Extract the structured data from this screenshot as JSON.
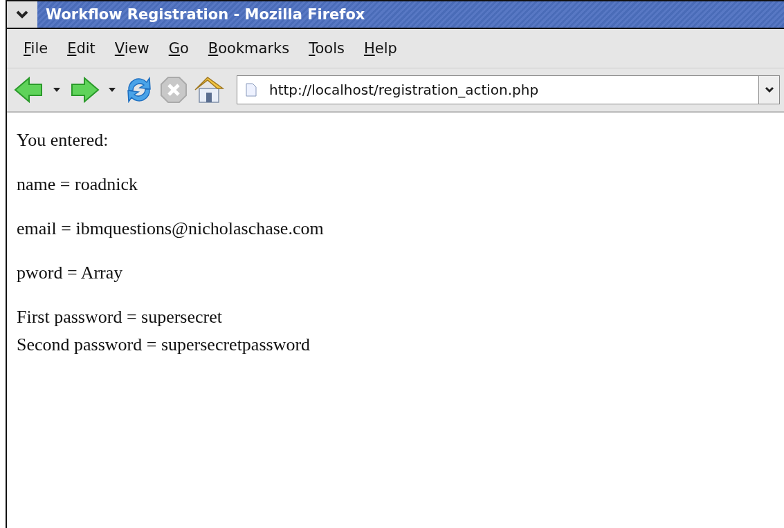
{
  "window": {
    "title": "Workflow Registration - Mozilla Firefox"
  },
  "menu": [
    "File",
    "Edit",
    "View",
    "Go",
    "Bookmarks",
    "Tools",
    "Help"
  ],
  "address": {
    "value": "http://localhost/registration_action.php"
  },
  "content": [
    {
      "lines": [
        "You entered:"
      ]
    },
    {
      "lines": [
        "name = roadnick"
      ]
    },
    {
      "lines": [
        "email = ibmquestions@nicholaschase.com"
      ]
    },
    {
      "lines": [
        "pword = Array"
      ]
    },
    {
      "lines": [
        "First password = supersecret",
        "Second password = supersecretpassword"
      ]
    }
  ]
}
